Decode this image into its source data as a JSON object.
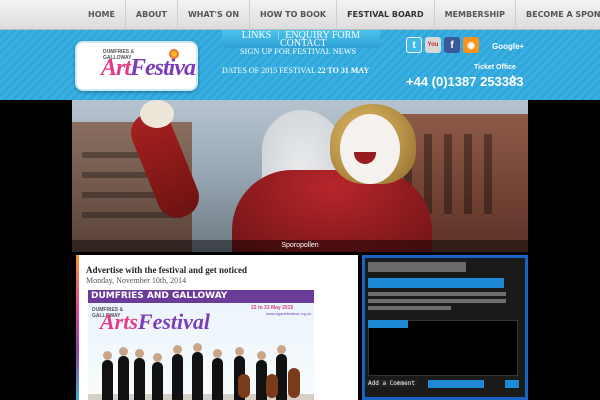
{
  "nav": {
    "items": [
      {
        "label": "HOME"
      },
      {
        "label": "ABOUT"
      },
      {
        "label": "WHAT'S ON"
      },
      {
        "label": "HOW TO BOOK"
      },
      {
        "label": "FESTIVAL BOARD"
      },
      {
        "label": "MEMBERSHIP"
      },
      {
        "label": "BECOME A SPONSOR"
      }
    ]
  },
  "subnav": {
    "links": "LINKS",
    "sep": "|",
    "enquiry": "ENQUIRY FORM",
    "contact": "CONTACT"
  },
  "header": {
    "logo_sub": "DUMFRIES & GALLOWAY",
    "logo_a": "Art",
    "logo_b": "Festival",
    "signup": "SIGN UP FOR FESTIVAL NEWS",
    "dates_prefix": "DATES OF 2015 FESTIVAL",
    "dates_value": "22 TO 31 MAY",
    "gplus": "Google+",
    "ticket_label": "Ticket Office",
    "ticket_phone": "+44 (0)1387 253383"
  },
  "social": {
    "twitter": "t",
    "youtube": "You",
    "facebook": "f",
    "rss": "◉"
  },
  "slider": {
    "caption": "Sporopollen",
    "prev": "‹",
    "next": "›"
  },
  "post": {
    "title": "Advertise with the festival and get noticed",
    "date": "Monday, November 10th, 2014",
    "banner": "DUMFRIES AND GALLOWAY",
    "img_sub": "DUMFRIES & GALLOWAY",
    "img_logo_a": "Arts",
    "img_logo_b": "Festival",
    "img_date": "22 to 31 May 2015",
    "img_url": "www.dgartsfestival.org.uk"
  },
  "sidebar": {
    "comment": "Add a Comment"
  }
}
